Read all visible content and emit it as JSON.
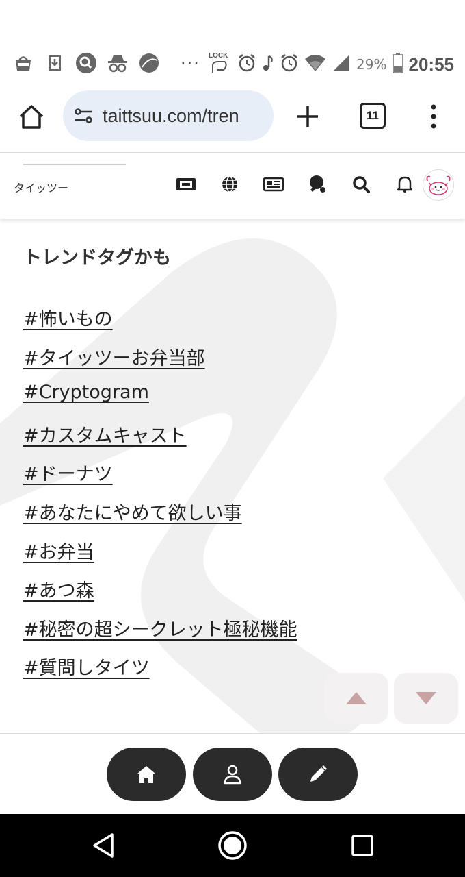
{
  "status_bar": {
    "left_icons": [
      "market-icon",
      "download-icon",
      "search-app-icon",
      "incognito-icon",
      "sphere-app-icon"
    ],
    "overflow": "···",
    "right_icons": [
      "lock-rotation-icon",
      "alarm-icon",
      "music-note-icon",
      "alarm-icon",
      "wifi-icon",
      "signal-icon"
    ],
    "battery": "29%",
    "time": "20:55"
  },
  "browser": {
    "url": "taittsuu.com/tren",
    "tab_count": "11"
  },
  "site_header": {
    "site_name": "タイッツー",
    "icons": [
      "ticket-icon",
      "globe-icon",
      "news-icon",
      "ping-pong-icon",
      "search-icon",
      "bell-icon"
    ],
    "avatar": "crab-avatar-icon"
  },
  "main": {
    "section_title": "トレンドタグかも",
    "tags": [
      "#怖いもの",
      "#タイッツーお弁当部",
      "#Cryptogram",
      "#カスタムキャスト",
      "#ドーナツ",
      "#あなたにやめて欲しい事",
      "#お弁当",
      "#あつ森",
      "#秘密の超シークレット極秘機能",
      "#質問しタイツ"
    ]
  },
  "scroll_buttons": [
    "scroll-up-icon",
    "scroll-down-icon"
  ],
  "bottom_nav": [
    "home-icon",
    "user-icon",
    "pencil-icon"
  ],
  "android_nav": [
    "back-icon",
    "home-circle-icon",
    "recents-icon"
  ],
  "colors": {
    "accent_pink": "#c9a3a3",
    "pill_dark": "#2b2b2b",
    "url_pill": "#e8eef8"
  }
}
